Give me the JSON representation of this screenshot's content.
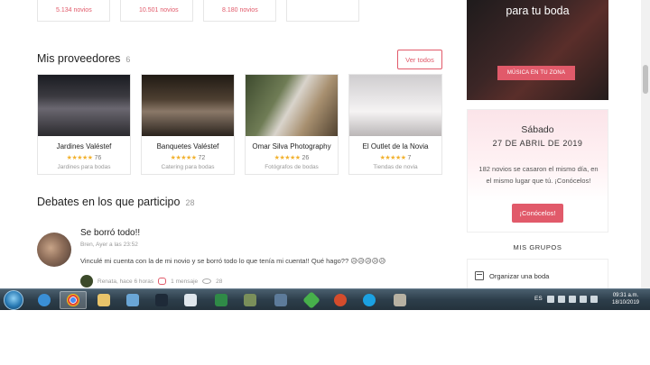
{
  "stats": [
    "5.134 novios",
    "10.501 novios",
    "8.180 novios"
  ],
  "providers": {
    "title": "Mis proveedores",
    "count": "6",
    "see_all": "Ver todos",
    "items": [
      {
        "name": "Jardines Valéstef",
        "stars": "★★★★★",
        "rating": "76",
        "category": "Jardines para bodas"
      },
      {
        "name": "Banquetes Valéstef",
        "stars": "★★★★★",
        "rating": "72",
        "category": "Catering para bodas"
      },
      {
        "name": "Omar Silva Photography",
        "stars": "★★★★★",
        "rating": "26",
        "category": "Fotógrafos de bodas"
      },
      {
        "name": "El Outlet de la Novia",
        "stars": "★★★★★",
        "rating": "7",
        "category": "Tiendas de novia"
      }
    ]
  },
  "debates": {
    "title": "Debates en los que participo",
    "count": "28",
    "post": {
      "title": "Se borró todo!!",
      "meta": "Bren, Ayer a las 23:52",
      "body": "Vinculé mi cuenta con la de mi novio y se borró todo lo que tenía mi cuenta!! Qué hago?? 😥😥😥😥😥",
      "last_reply": "Renata, hace 6 horas",
      "messages": "1 mensaje",
      "views": "28"
    }
  },
  "sidebar": {
    "music_title": "para tu boda",
    "music_button": "MÚSICA EN TU ZONA",
    "date_day": "Sábado",
    "date_full": "27 DE ABRIL DE 2019",
    "date_text": "182 novios se casaron el mismo día, en el mismo lugar que tú. ¡Conócelos!",
    "date_button": "¡Conócelos!",
    "groups_title": "MIS GRUPOS",
    "groups_item": "Organizar una boda"
  },
  "taskbar": {
    "lang": "ES",
    "time": "09:31 a.m.",
    "date": "18/10/2019"
  }
}
